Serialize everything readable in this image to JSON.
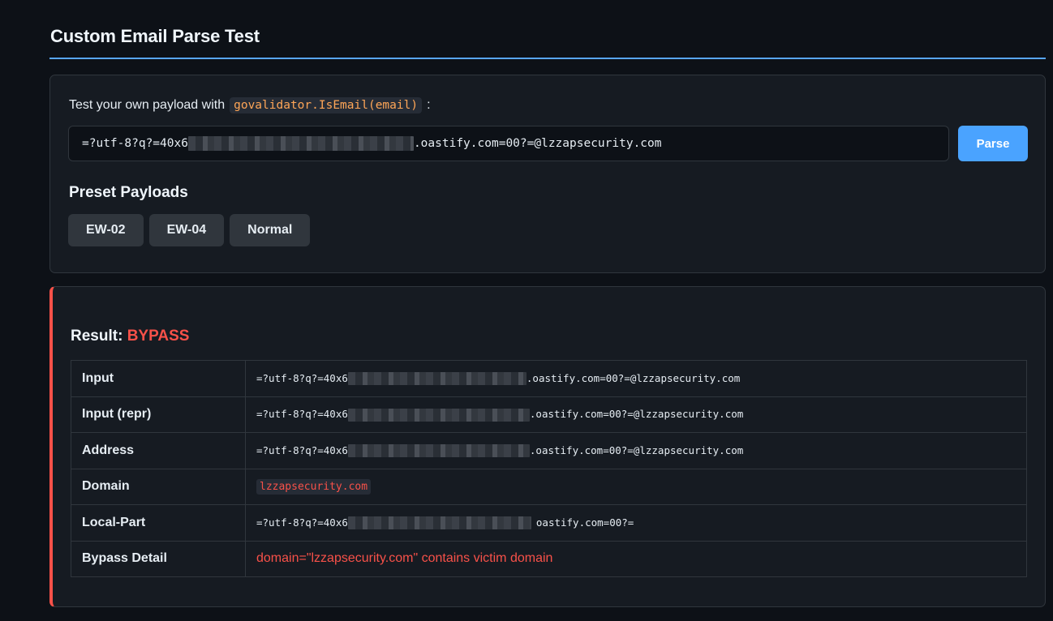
{
  "page": {
    "title": "Custom Email Parse Test"
  },
  "test_panel": {
    "prompt_prefix": "Test your own payload with",
    "function_name": "govalidator.IsEmail(email)",
    "prompt_suffix": ":",
    "input_value_start": "=?utf-8?q?=40x6",
    "input_value_end": ".oastify.com=00?=@lzzapsecurity.com",
    "parse_label": "Parse",
    "presets_heading": "Preset Payloads",
    "presets": [
      "EW-02",
      "EW-04",
      "Normal"
    ]
  },
  "result": {
    "label": "Result:",
    "status": "BYPASS",
    "rows": [
      {
        "key": "Input",
        "value_start": "=?utf-8?q?=40x6",
        "value_end": ".oastify.com=00?=@lzzapsecurity.com"
      },
      {
        "key": "Input (repr)",
        "value_start": "=?utf-8?q?=40x6",
        "value_end": ".oastify.com=00?=@lzzapsecurity.com"
      },
      {
        "key": "Address",
        "value_start": "=?utf-8?q?=40x6",
        "value_end": ".oastify.com=00?=@lzzapsecurity.com"
      },
      {
        "key": "Domain",
        "value": "lzzapsecurity.com"
      },
      {
        "key": "Local-Part",
        "value_start": "=?utf-8?q?=40x6",
        "value_end": "oastify.com=00?="
      },
      {
        "key": "Bypass Detail",
        "value": "domain=\"lzzapsecurity.com\" contains victim domain"
      }
    ]
  },
  "colors": {
    "background": "#0d1117",
    "panel": "#161b22",
    "accent": "#58a6ff",
    "button": "#4aa3ff",
    "danger": "#f85149",
    "code": "#ffa657"
  }
}
